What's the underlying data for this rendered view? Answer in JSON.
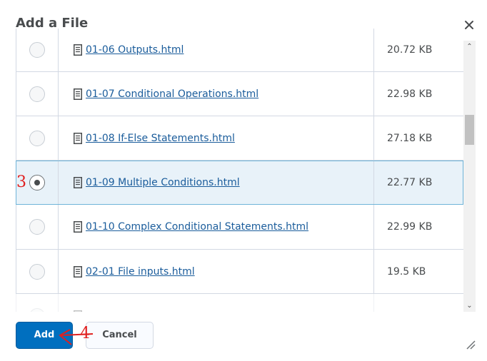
{
  "dialog": {
    "title": "Add a File",
    "close_icon": "close-icon"
  },
  "files": [
    {
      "name": "01-06 Outputs.html",
      "size": "20.72 KB",
      "selected": false
    },
    {
      "name": "01-07 Conditional Operations.html",
      "size": "22.98 KB",
      "selected": false
    },
    {
      "name": "01-08 If-Else Statements.html",
      "size": "27.18 KB",
      "selected": false
    },
    {
      "name": "01-09 Multiple Conditions.html",
      "size": "22.77 KB",
      "selected": true
    },
    {
      "name": "01-10 Complex Conditional Statements.html",
      "size": "22.99 KB",
      "selected": false
    },
    {
      "name": "02-01 File inputs.html",
      "size": "19.5 KB",
      "selected": false
    },
    {
      "name": "",
      "size": "",
      "selected": false
    }
  ],
  "footer": {
    "add_label": "Add",
    "cancel_label": "Cancel"
  },
  "annotations": {
    "step_3": "3",
    "step_4": "4",
    "color": "#e02020"
  },
  "colors": {
    "primary": "#006fbf",
    "link": "#1a5c9b",
    "selected_row": "#e8f2f9",
    "selected_border": "#6fb4d9"
  }
}
